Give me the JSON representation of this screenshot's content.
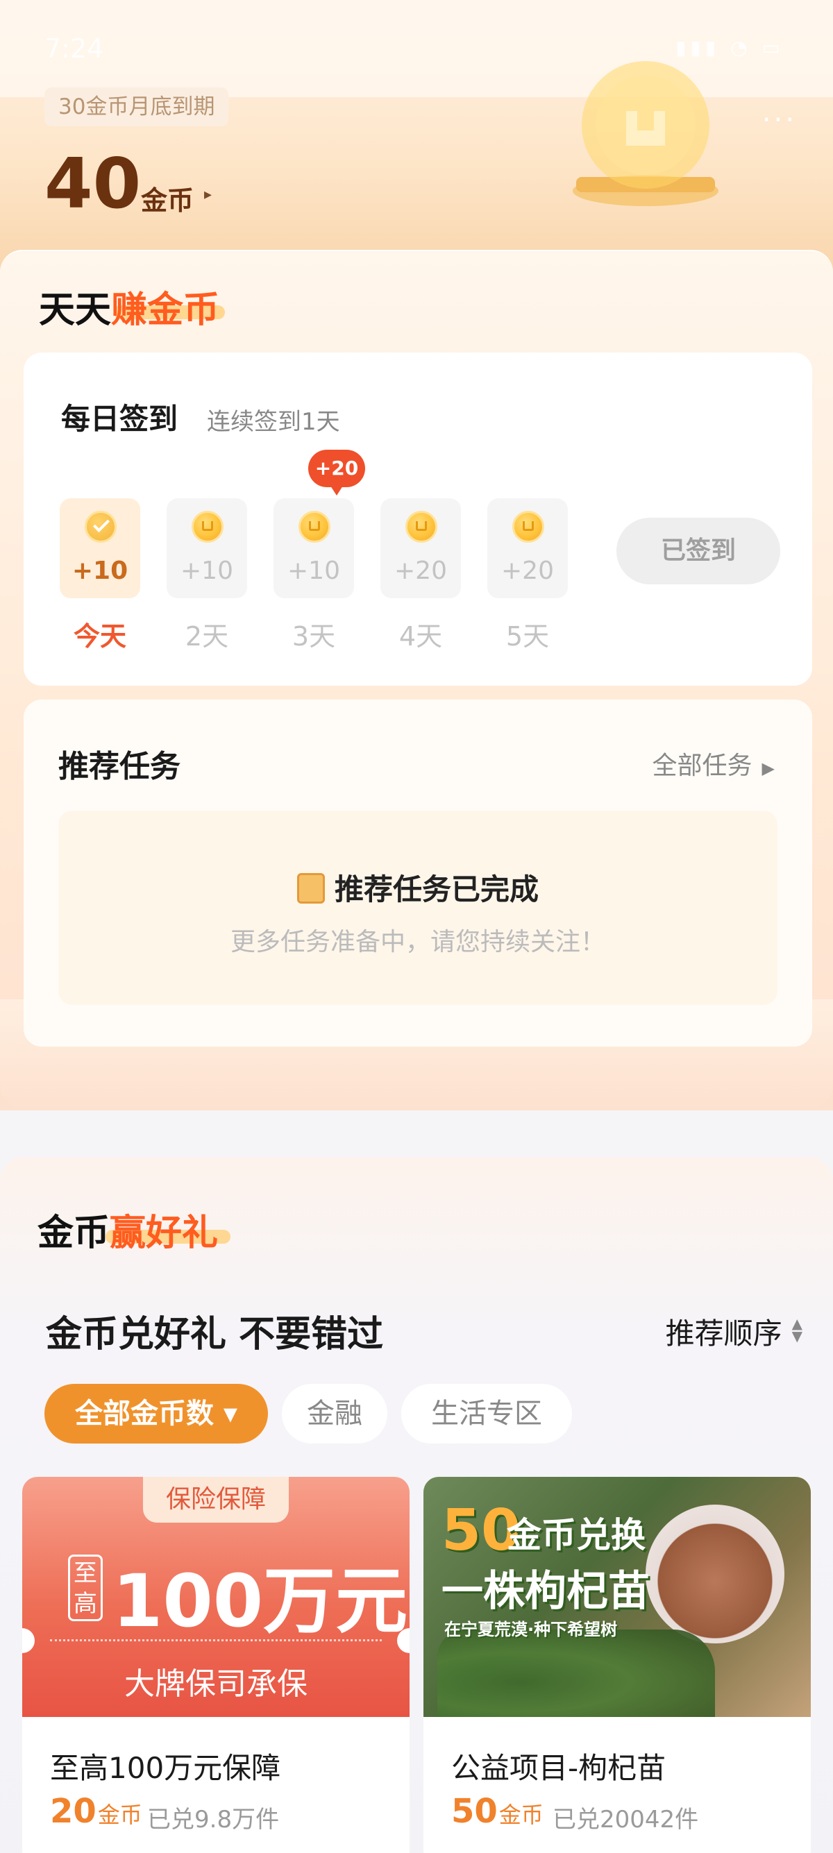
{
  "status": {
    "time": "7:24",
    "icons": "▮▮▮ ◔ ▭"
  },
  "header": {
    "expire_tag": "30金币月底到期",
    "coin_amount": "40",
    "coin_unit": "金币",
    "coin_arrow": "▸",
    "more": "···"
  },
  "earn": {
    "title_plain": "天天",
    "title_highlight": "赚金币",
    "checkin": {
      "title": "每日签到",
      "streak": "连续签到1天",
      "bonus": "+20",
      "days": [
        {
          "points": "+10",
          "label": "今天",
          "today": true
        },
        {
          "points": "+10",
          "label": "2天"
        },
        {
          "points": "+10",
          "label": "3天"
        },
        {
          "points": "+20",
          "label": "4天"
        },
        {
          "points": "+20",
          "label": "5天"
        }
      ],
      "button": "已签到"
    },
    "tasks": {
      "title": "推荐任务",
      "all_link": "全部任务",
      "done_title": "推荐任务已完成",
      "done_sub": "更多任务准备中，请您持续关注！"
    }
  },
  "gifts": {
    "title_plain": "金币",
    "title_highlight": "赢好礼",
    "headline": "金币兑好礼 不要错过",
    "sort": "推荐顺序",
    "chips": [
      {
        "label": "全部金币数 ▾",
        "active": true
      },
      {
        "label": "金融"
      },
      {
        "label": "生活专区"
      }
    ],
    "products": [
      {
        "tag": "保险保障",
        "prefix": "至高",
        "amount": "100万元",
        "note": "大牌保司承保",
        "name": "至高100万元保障",
        "price": "20",
        "unit": "金币",
        "sold": "已兑9.8万件"
      },
      {
        "banner_num": "50",
        "banner_line1": "金币兑换",
        "banner_line2": "一株枸杞苗",
        "banner_sub": "在宁夏荒漠·种下希望树",
        "name": "公益项目-枸杞苗",
        "price": "50",
        "unit": "金币",
        "sold": "已兑20042件"
      }
    ]
  },
  "colors": {
    "accent": "#f0822c",
    "highlight": "#ff5c1f",
    "badge": "#ef4f2a",
    "coin_text": "#6b3210"
  }
}
